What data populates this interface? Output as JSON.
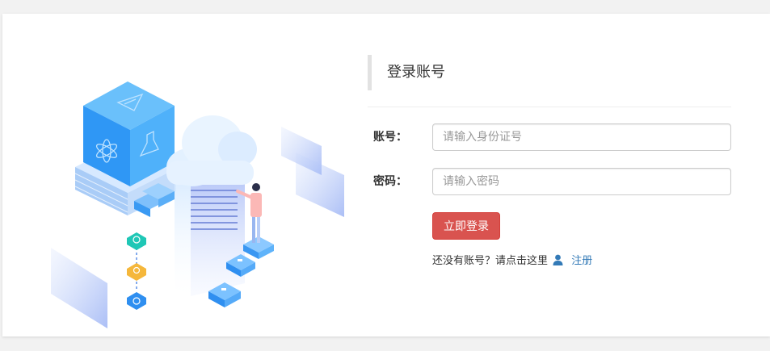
{
  "login": {
    "title": "登录账号",
    "account_label": "账号：",
    "account_placeholder": "请输入身份证号",
    "password_label": "密码：",
    "password_placeholder": "请输入密码",
    "login_button": "立即登录",
    "no_account_text": "还没有账号？请点击这里",
    "register_link": "注册"
  },
  "icons": {
    "user": "user-icon"
  },
  "colors": {
    "login_button": "#d9534f",
    "link": "#337ab7",
    "illustration_blue": "#3da4f7"
  }
}
